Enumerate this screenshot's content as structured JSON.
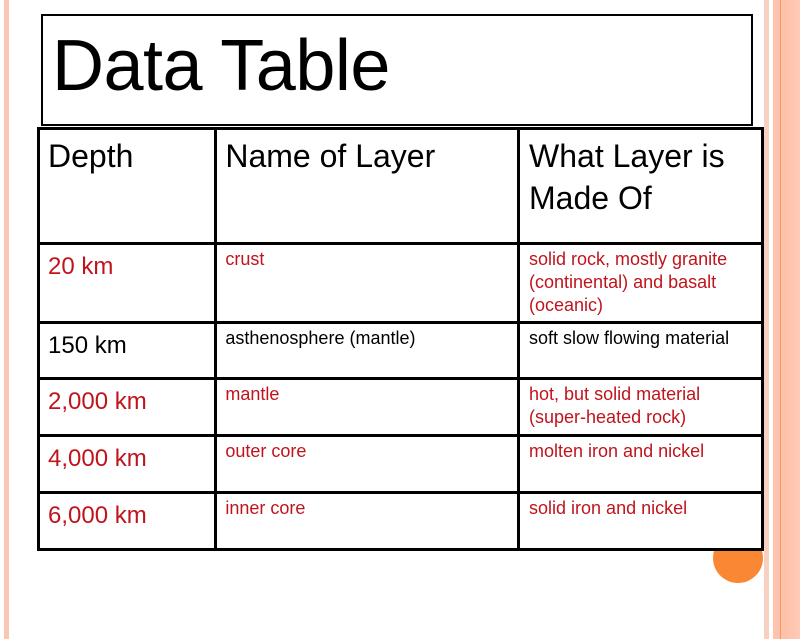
{
  "slide": {
    "title": "Data Table",
    "colors": {
      "highlight_text": "#c0141c",
      "normal_text": "#000000",
      "accent_stripe": "#fdc1aa",
      "accent_dot": "#fa8733"
    }
  },
  "table": {
    "headers": [
      "Depth",
      "Name of Layer",
      "What Layer is Made Of"
    ],
    "rows": [
      {
        "depth": "20 km",
        "name": "crust",
        "made_of": "solid rock, mostly granite (continental) and basalt (oceanic)",
        "highlighted": true
      },
      {
        "depth": "150 km",
        "name": "asthenosphere (mantle)",
        "made_of": "soft slow flowing material",
        "highlighted": false
      },
      {
        "depth": "2,000 km",
        "name": "mantle",
        "made_of": "hot, but solid material (super-heated rock)",
        "highlighted": true
      },
      {
        "depth": "4,000 km",
        "name": "outer core",
        "made_of": "molten iron and nickel",
        "highlighted": true
      },
      {
        "depth": "6,000 km",
        "name": "inner core",
        "made_of": "solid iron and nickel",
        "highlighted": true
      }
    ]
  }
}
